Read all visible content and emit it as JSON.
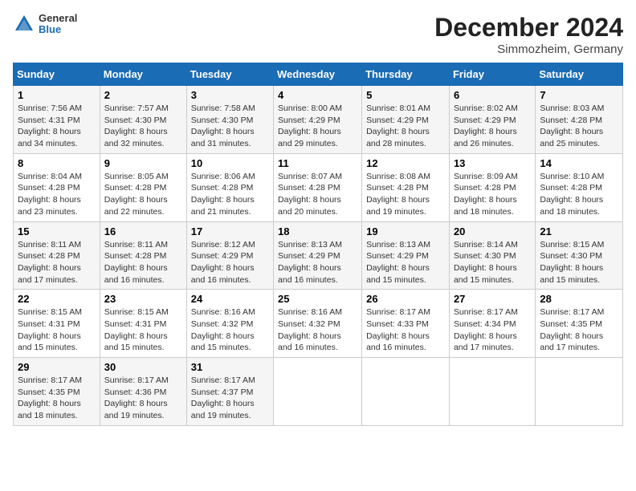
{
  "header": {
    "logo_line1": "General",
    "logo_line2": "Blue",
    "month": "December 2024",
    "location": "Simmozheim, Germany"
  },
  "weekdays": [
    "Sunday",
    "Monday",
    "Tuesday",
    "Wednesday",
    "Thursday",
    "Friday",
    "Saturday"
  ],
  "weeks": [
    [
      {
        "day": "1",
        "sunrise": "7:56 AM",
        "sunset": "4:31 PM",
        "daylight": "8 hours and 34 minutes."
      },
      {
        "day": "2",
        "sunrise": "7:57 AM",
        "sunset": "4:30 PM",
        "daylight": "8 hours and 32 minutes."
      },
      {
        "day": "3",
        "sunrise": "7:58 AM",
        "sunset": "4:30 PM",
        "daylight": "8 hours and 31 minutes."
      },
      {
        "day": "4",
        "sunrise": "8:00 AM",
        "sunset": "4:29 PM",
        "daylight": "8 hours and 29 minutes."
      },
      {
        "day": "5",
        "sunrise": "8:01 AM",
        "sunset": "4:29 PM",
        "daylight": "8 hours and 28 minutes."
      },
      {
        "day": "6",
        "sunrise": "8:02 AM",
        "sunset": "4:29 PM",
        "daylight": "8 hours and 26 minutes."
      },
      {
        "day": "7",
        "sunrise": "8:03 AM",
        "sunset": "4:28 PM",
        "daylight": "8 hours and 25 minutes."
      }
    ],
    [
      {
        "day": "8",
        "sunrise": "8:04 AM",
        "sunset": "4:28 PM",
        "daylight": "8 hours and 23 minutes."
      },
      {
        "day": "9",
        "sunrise": "8:05 AM",
        "sunset": "4:28 PM",
        "daylight": "8 hours and 22 minutes."
      },
      {
        "day": "10",
        "sunrise": "8:06 AM",
        "sunset": "4:28 PM",
        "daylight": "8 hours and 21 minutes."
      },
      {
        "day": "11",
        "sunrise": "8:07 AM",
        "sunset": "4:28 PM",
        "daylight": "8 hours and 20 minutes."
      },
      {
        "day": "12",
        "sunrise": "8:08 AM",
        "sunset": "4:28 PM",
        "daylight": "8 hours and 19 minutes."
      },
      {
        "day": "13",
        "sunrise": "8:09 AM",
        "sunset": "4:28 PM",
        "daylight": "8 hours and 18 minutes."
      },
      {
        "day": "14",
        "sunrise": "8:10 AM",
        "sunset": "4:28 PM",
        "daylight": "8 hours and 18 minutes."
      }
    ],
    [
      {
        "day": "15",
        "sunrise": "8:11 AM",
        "sunset": "4:28 PM",
        "daylight": "8 hours and 17 minutes."
      },
      {
        "day": "16",
        "sunrise": "8:11 AM",
        "sunset": "4:28 PM",
        "daylight": "8 hours and 16 minutes."
      },
      {
        "day": "17",
        "sunrise": "8:12 AM",
        "sunset": "4:29 PM",
        "daylight": "8 hours and 16 minutes."
      },
      {
        "day": "18",
        "sunrise": "8:13 AM",
        "sunset": "4:29 PM",
        "daylight": "8 hours and 16 minutes."
      },
      {
        "day": "19",
        "sunrise": "8:13 AM",
        "sunset": "4:29 PM",
        "daylight": "8 hours and 15 minutes."
      },
      {
        "day": "20",
        "sunrise": "8:14 AM",
        "sunset": "4:30 PM",
        "daylight": "8 hours and 15 minutes."
      },
      {
        "day": "21",
        "sunrise": "8:15 AM",
        "sunset": "4:30 PM",
        "daylight": "8 hours and 15 minutes."
      }
    ],
    [
      {
        "day": "22",
        "sunrise": "8:15 AM",
        "sunset": "4:31 PM",
        "daylight": "8 hours and 15 minutes."
      },
      {
        "day": "23",
        "sunrise": "8:15 AM",
        "sunset": "4:31 PM",
        "daylight": "8 hours and 15 minutes."
      },
      {
        "day": "24",
        "sunrise": "8:16 AM",
        "sunset": "4:32 PM",
        "daylight": "8 hours and 15 minutes."
      },
      {
        "day": "25",
        "sunrise": "8:16 AM",
        "sunset": "4:32 PM",
        "daylight": "8 hours and 16 minutes."
      },
      {
        "day": "26",
        "sunrise": "8:17 AM",
        "sunset": "4:33 PM",
        "daylight": "8 hours and 16 minutes."
      },
      {
        "day": "27",
        "sunrise": "8:17 AM",
        "sunset": "4:34 PM",
        "daylight": "8 hours and 17 minutes."
      },
      {
        "day": "28",
        "sunrise": "8:17 AM",
        "sunset": "4:35 PM",
        "daylight": "8 hours and 17 minutes."
      }
    ],
    [
      {
        "day": "29",
        "sunrise": "8:17 AM",
        "sunset": "4:35 PM",
        "daylight": "8 hours and 18 minutes."
      },
      {
        "day": "30",
        "sunrise": "8:17 AM",
        "sunset": "4:36 PM",
        "daylight": "8 hours and 19 minutes."
      },
      {
        "day": "31",
        "sunrise": "8:17 AM",
        "sunset": "4:37 PM",
        "daylight": "8 hours and 19 minutes."
      },
      null,
      null,
      null,
      null
    ]
  ]
}
